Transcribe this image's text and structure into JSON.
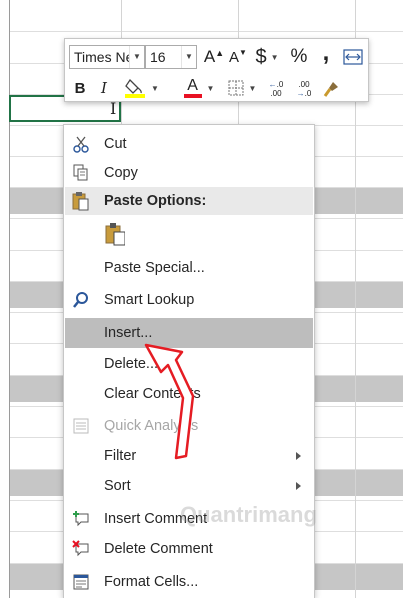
{
  "mini_toolbar": {
    "font_name": "Times Ne",
    "font_size": "16",
    "grow_font": "A",
    "shrink_font": "A",
    "currency_symbol": "$",
    "percent_symbol": "%",
    "comma_symbol": ",",
    "bold": "B",
    "italic": "I",
    "font_color_letter": "A",
    "font_color": "#e81123",
    "fill_color": "#ffff00",
    "inc_decimal": ".00",
    "dec_decimal": ".0"
  },
  "menu": {
    "cut": "Cut",
    "copy": "Copy",
    "paste_options": "Paste Options:",
    "paste_special": "Paste Special...",
    "smart_lookup": "Smart Lookup",
    "insert": "Insert...",
    "delete": "Delete...",
    "clear_contents": "Clear Contents",
    "quick_analysis": "Quick Analysis",
    "filter": "Filter",
    "sort": "Sort",
    "insert_comment": "Insert Comment",
    "delete_comment": "Delete Comment",
    "format_cells": "Format Cells..."
  },
  "watermark": "Quantrimang",
  "colors": {
    "selection_border": "#217346",
    "highlight": "#bdbdbd",
    "arrow": "#e51c23"
  }
}
